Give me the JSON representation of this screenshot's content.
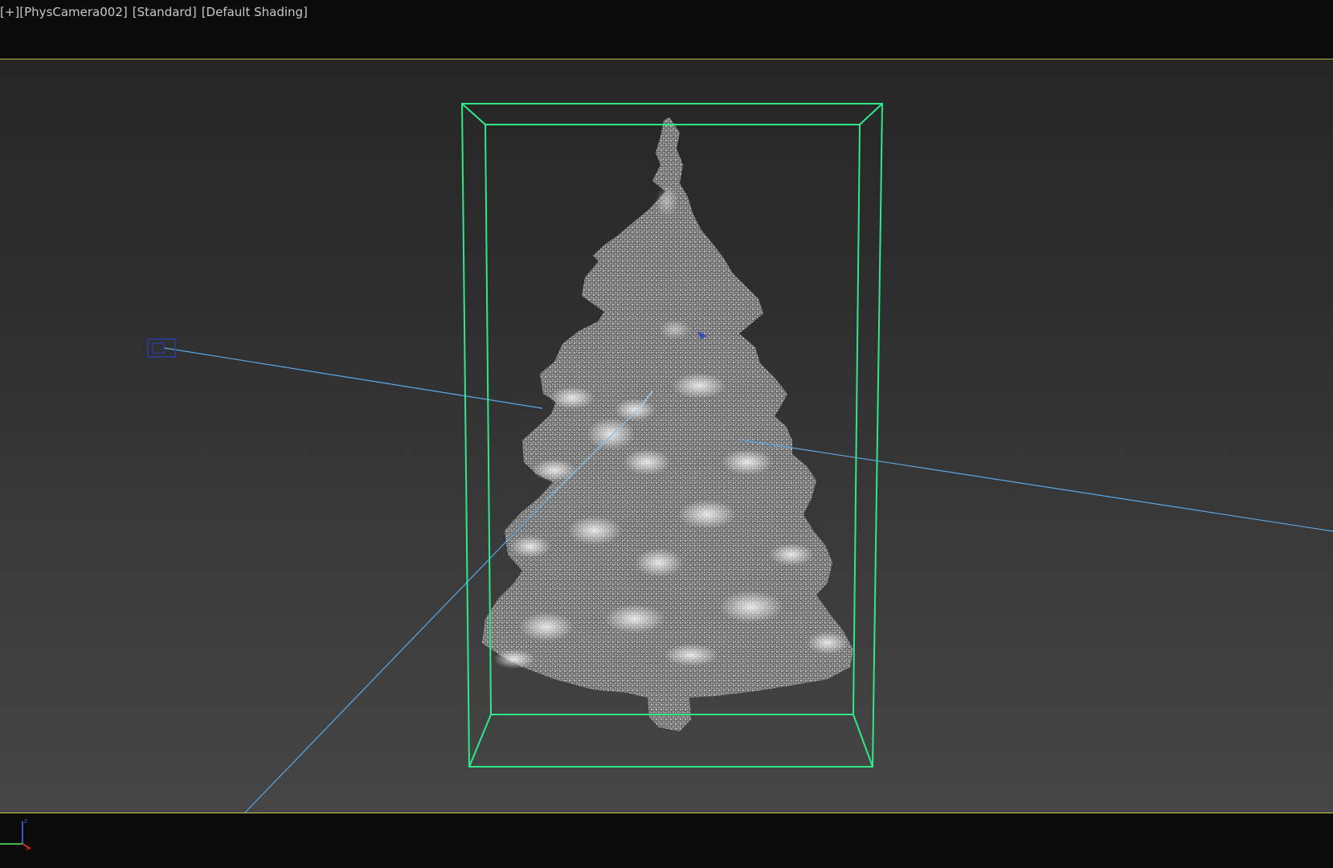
{
  "viewport": {
    "label": {
      "menu": "[+]",
      "camera": "[PhysCamera002]",
      "mode": "[Standard]",
      "shading": "[Default Shading]"
    },
    "colors": {
      "background_top": "#262626",
      "background_bottom": "#464646",
      "bounding_box": "#2ee88a",
      "camera_line": "#5aa8e6",
      "camera_icon": "#2a3fa0",
      "active_border": "#c9c94a",
      "point_cloud": "#d0d0d0"
    }
  },
  "scene": {
    "object": "point-cloud-christmas-tree",
    "gizmos": [
      "bounding-box",
      "camera",
      "camera-target-lines"
    ]
  }
}
